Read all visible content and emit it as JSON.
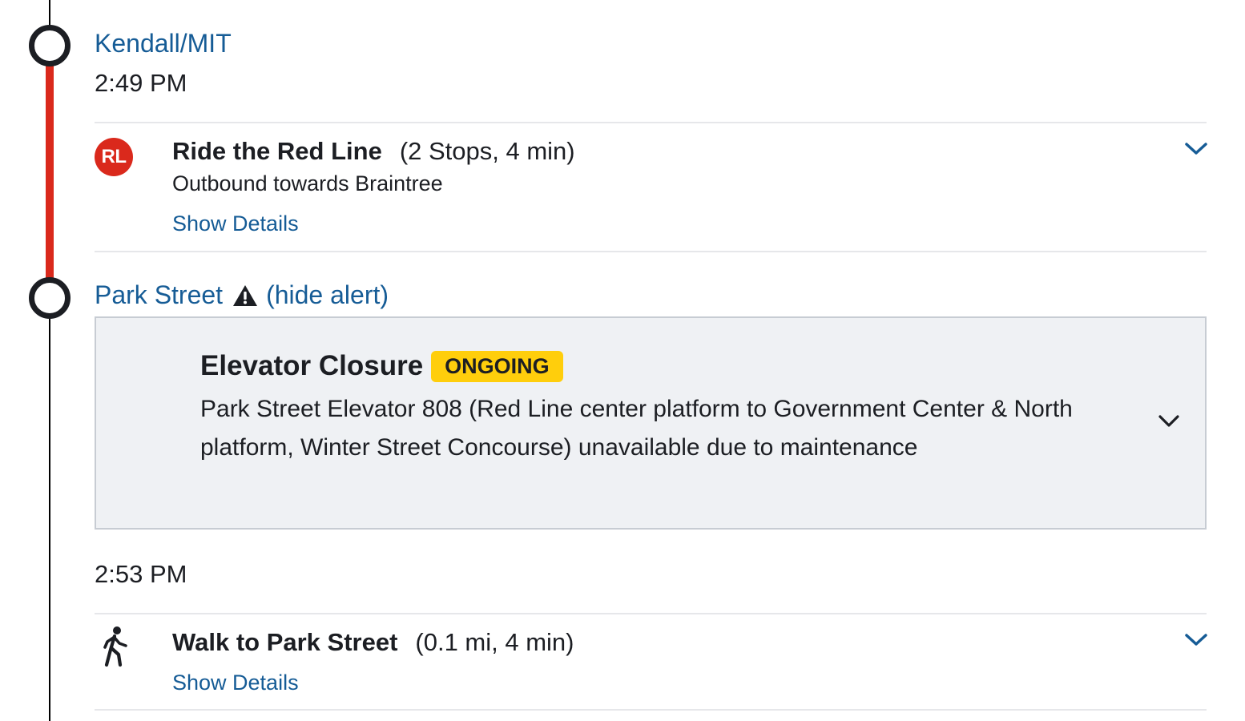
{
  "origin_stop": {
    "name": "Kendall/MIT",
    "time": "2:49 PM"
  },
  "transit_leg": {
    "badge": "RL",
    "title": "Ride the Red Line",
    "meta": "(2 Stops, 4 min)",
    "direction": "Outbound towards Braintree",
    "show_details": "Show Details",
    "icon": "chevron-down-icon",
    "line_color": "#da291c"
  },
  "transfer_stop": {
    "name": "Park Street",
    "hide_alert": "(hide alert)",
    "icon": "warning-icon",
    "time": "2:53 PM"
  },
  "alert": {
    "title": "Elevator Closure",
    "badge": "ONGOING",
    "badge_color": "#ffce0c",
    "body": "Park Street Elevator 808 (Red Line center platform to Government Center & North platform, Winter Street Concourse) unavailable due to maintenance"
  },
  "walk_leg": {
    "title": "Walk to Park Street",
    "meta": "(0.1 mi, 4 min)",
    "show_details": "Show Details",
    "icon": "walking-person-icon"
  },
  "colors": {
    "link": "#165c96",
    "text": "#1c1e23",
    "alert_bg": "#eff1f4"
  }
}
